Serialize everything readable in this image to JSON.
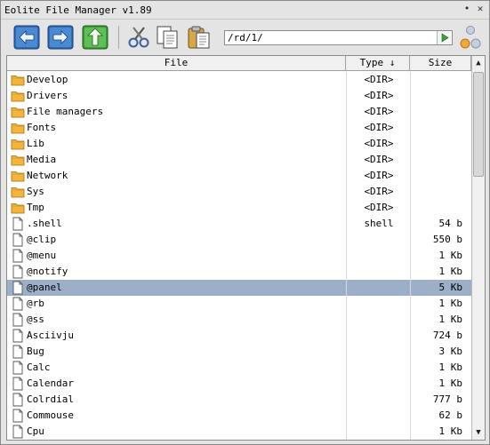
{
  "window": {
    "title": "Eolite File Manager v1.89"
  },
  "titlebar": {
    "minimize_glyph": "•",
    "close_glyph": "✕"
  },
  "toolbar": {
    "back_icon": "arrow-left-icon",
    "forward_icon": "arrow-right-icon",
    "up_icon": "arrow-up-icon",
    "cut_icon": "scissors-icon",
    "copy_icon": "copy-icon",
    "paste_icon": "paste-icon"
  },
  "path": {
    "value": "/rd/1/"
  },
  "columns": {
    "file": "File",
    "type": "Type ↓",
    "size": "Size"
  },
  "scrollbar": {
    "up_glyph": "▲",
    "down_glyph": "▼"
  },
  "files": [
    {
      "name": "Develop",
      "type": "<DIR>",
      "size": "",
      "kind": "folder"
    },
    {
      "name": "Drivers",
      "type": "<DIR>",
      "size": "",
      "kind": "folder"
    },
    {
      "name": "File managers",
      "type": "<DIR>",
      "size": "",
      "kind": "folder"
    },
    {
      "name": "Fonts",
      "type": "<DIR>",
      "size": "",
      "kind": "folder"
    },
    {
      "name": "Lib",
      "type": "<DIR>",
      "size": "",
      "kind": "folder"
    },
    {
      "name": "Media",
      "type": "<DIR>",
      "size": "",
      "kind": "folder"
    },
    {
      "name": "Network",
      "type": "<DIR>",
      "size": "",
      "kind": "folder"
    },
    {
      "name": "Sys",
      "type": "<DIR>",
      "size": "",
      "kind": "folder"
    },
    {
      "name": "Tmp",
      "type": "<DIR>",
      "size": "",
      "kind": "folder"
    },
    {
      "name": ".shell",
      "type": "shell",
      "size": "54 b",
      "kind": "file"
    },
    {
      "name": "@clip",
      "type": "",
      "size": "550 b",
      "kind": "file"
    },
    {
      "name": "@menu",
      "type": "",
      "size": "1 Kb",
      "kind": "file"
    },
    {
      "name": "@notify",
      "type": "",
      "size": "1 Kb",
      "kind": "file"
    },
    {
      "name": "@panel",
      "type": "",
      "size": "5 Kb",
      "kind": "file",
      "selected": true
    },
    {
      "name": "@rb",
      "type": "",
      "size": "1 Kb",
      "kind": "file"
    },
    {
      "name": "@ss",
      "type": "",
      "size": "1 Kb",
      "kind": "file"
    },
    {
      "name": "Asciivju",
      "type": "",
      "size": "724 b",
      "kind": "file"
    },
    {
      "name": "Bug",
      "type": "",
      "size": "3 Kb",
      "kind": "file"
    },
    {
      "name": "Calc",
      "type": "",
      "size": "1 Kb",
      "kind": "file"
    },
    {
      "name": "Calendar",
      "type": "",
      "size": "1 Kb",
      "kind": "file"
    },
    {
      "name": "Colrdial",
      "type": "",
      "size": "777 b",
      "kind": "file"
    },
    {
      "name": "Commouse",
      "type": "",
      "size": "62 b",
      "kind": "file"
    },
    {
      "name": "Cpu",
      "type": "",
      "size": "1 Kb",
      "kind": "file"
    }
  ],
  "colors": {
    "selection": "#9bb0c8",
    "folder": "#f3b53a",
    "nav_blue": "#2e6db6",
    "nav_green": "#3f9a3a"
  }
}
